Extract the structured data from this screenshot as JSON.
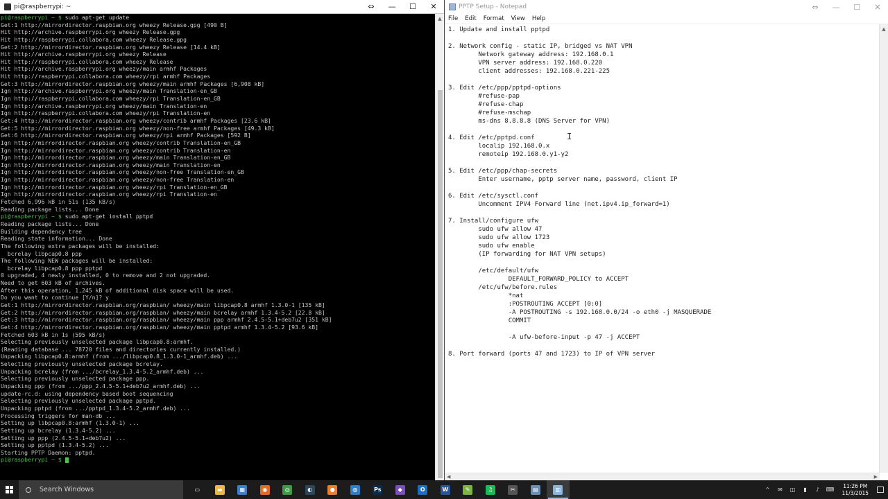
{
  "terminal": {
    "title": "pi@raspberrypi: ~",
    "controls": {
      "resize": "⇔",
      "minimize": "—",
      "maximize": "☐",
      "close": "✕"
    },
    "lines": [
      {
        "prompt": "pi@raspberrypi ~ $ ",
        "text": "sudo apt-get update"
      },
      {
        "text": "Get:1 http://mirrordirector.raspbian.org wheezy Release.gpg [490 B]"
      },
      {
        "text": "Hit http://archive.raspberrypi.org wheezy Release.gpg"
      },
      {
        "text": "Hit http://raspberrypi.collabora.com wheezy Release.gpg"
      },
      {
        "text": "Get:2 http://mirrordirector.raspbian.org wheezy Release [14.4 kB]"
      },
      {
        "text": "Hit http://archive.raspberrypi.org wheezy Release"
      },
      {
        "text": "Hit http://raspberrypi.collabora.com wheezy Release"
      },
      {
        "text": "Hit http://archive.raspberrypi.org wheezy/main armhf Packages"
      },
      {
        "text": "Hit http://raspberrypi.collabora.com wheezy/rpi armhf Packages"
      },
      {
        "text": "Get:3 http://mirrordirector.raspbian.org wheezy/main armhf Packages [6,908 kB]"
      },
      {
        "text": "Ign http://archive.raspberrypi.org wheezy/main Translation-en_GB"
      },
      {
        "text": "Ign http://raspberrypi.collabora.com wheezy/rpi Translation-en_GB"
      },
      {
        "text": "Ign http://archive.raspberrypi.org wheezy/main Translation-en"
      },
      {
        "text": "Ign http://raspberrypi.collabora.com wheezy/rpi Translation-en"
      },
      {
        "text": "Get:4 http://mirrordirector.raspbian.org wheezy/contrib armhf Packages [23.6 kB]"
      },
      {
        "text": "Get:5 http://mirrordirector.raspbian.org wheezy/non-free armhf Packages [49.3 kB]"
      },
      {
        "text": "Get:6 http://mirrordirector.raspbian.org wheezy/rpi armhf Packages [592 B]"
      },
      {
        "text": "Ign http://mirrordirector.raspbian.org wheezy/contrib Translation-en_GB"
      },
      {
        "text": "Ign http://mirrordirector.raspbian.org wheezy/contrib Translation-en"
      },
      {
        "text": "Ign http://mirrordirector.raspbian.org wheezy/main Translation-en_GB"
      },
      {
        "text": "Ign http://mirrordirector.raspbian.org wheezy/main Translation-en"
      },
      {
        "text": "Ign http://mirrordirector.raspbian.org wheezy/non-free Translation-en_GB"
      },
      {
        "text": "Ign http://mirrordirector.raspbian.org wheezy/non-free Translation-en"
      },
      {
        "text": "Ign http://mirrordirector.raspbian.org wheezy/rpi Translation-en_GB"
      },
      {
        "text": "Ign http://mirrordirector.raspbian.org wheezy/rpi Translation-en"
      },
      {
        "text": "Fetched 6,996 kB in 51s (135 kB/s)"
      },
      {
        "text": "Reading package lists... Done"
      },
      {
        "prompt": "pi@raspberrypi ~ $ ",
        "text": "sudo apt-get install pptpd"
      },
      {
        "text": "Reading package lists... Done"
      },
      {
        "text": "Building dependency tree"
      },
      {
        "text": "Reading state information... Done"
      },
      {
        "text": "The following extra packages will be installed:"
      },
      {
        "text": "  bcrelay libpcap0.8 ppp"
      },
      {
        "text": "The following NEW packages will be installed:"
      },
      {
        "text": "  bcrelay libpcap0.8 ppp pptpd"
      },
      {
        "text": "0 upgraded, 4 newly installed, 0 to remove and 2 not upgraded."
      },
      {
        "text": "Need to get 603 kB of archives."
      },
      {
        "text": "After this operation, 1,245 kB of additional disk space will be used."
      },
      {
        "text": "Do you want to continue [Y/n]? y"
      },
      {
        "text": "Get:1 http://mirrordirector.raspbian.org/raspbian/ wheezy/main libpcap0.8 armhf 1.3.0-1 [135 kB]"
      },
      {
        "text": "Get:2 http://mirrordirector.raspbian.org/raspbian/ wheezy/main bcrelay armhf 1.3.4-5.2 [22.8 kB]"
      },
      {
        "text": "Get:3 http://mirrordirector.raspbian.org/raspbian/ wheezy/main ppp armhf 2.4.5-5.1+deb7u2 [351 kB]"
      },
      {
        "text": "Get:4 http://mirrordirector.raspbian.org/raspbian/ wheezy/main pptpd armhf 1.3.4-5.2 [93.6 kB]"
      },
      {
        "text": "Fetched 603 kB in 1s (595 kB/s)"
      },
      {
        "text": "Selecting previously unselected package libpcap0.8:armhf."
      },
      {
        "text": "(Reading database ... 78720 files and directories currently installed.)"
      },
      {
        "text": "Unpacking libpcap0.8:armhf (from .../libpcap0.8_1.3.0-1_armhf.deb) ..."
      },
      {
        "text": "Selecting previously unselected package bcrelay."
      },
      {
        "text": "Unpacking bcrelay (from .../bcrelay_1.3.4-5.2_armhf.deb) ..."
      },
      {
        "text": "Selecting previously unselected package ppp."
      },
      {
        "text": "Unpacking ppp (from .../ppp_2.4.5-5.1+deb7u2_armhf.deb) ..."
      },
      {
        "text": "update-rc.d: using dependency based boot sequencing"
      },
      {
        "text": "Selecting previously unselected package pptpd."
      },
      {
        "text": "Unpacking pptpd (from .../pptpd_1.3.4-5.2_armhf.deb) ..."
      },
      {
        "text": "Processing triggers for man-db ..."
      },
      {
        "text": "Setting up libpcap0.8:armhf (1.3.0-1) ..."
      },
      {
        "text": "Setting up bcrelay (1.3.4-5.2) ..."
      },
      {
        "text": "Setting up ppp (2.4.5-5.1+deb7u2) ..."
      },
      {
        "text": "Setting up pptpd (1.3.4-5.2) ..."
      },
      {
        "text": "Starting PPTP Daemon: pptpd."
      },
      {
        "prompt": "pi@raspberrypi ~ $ ",
        "text": "",
        "cursor": true
      }
    ]
  },
  "notepad": {
    "title": "PPTP Setup - Notepad",
    "controls": {
      "resize": "⇔",
      "minimize": "—",
      "maximize": "☐",
      "close": "✕"
    },
    "menu": [
      "File",
      "Edit",
      "Format",
      "View",
      "Help"
    ],
    "lines": [
      "1. Update and install pptpd",
      "",
      "2. Network config - static IP, bridged vs NAT VPN",
      "        Network gateway address: 192.168.0.1",
      "        VPN server address: 192.168.0.220",
      "        client addresses: 192.168.0.221-225",
      "",
      "3. Edit /etc/ppp/pptpd-options",
      "        #refuse-pap",
      "        #refuse-chap",
      "        #refuse-mschap",
      "        ms-dns 8.8.8.8 (DNS Server for VPN)",
      "",
      "4. Edit /etc/pptpd.conf",
      "        localip 192.168.0.x",
      "        remoteip 192.168.0.y1-y2",
      "",
      "5. Edit /etc/ppp/chap-secrets",
      "        Enter username, pptp server name, password, client IP",
      "",
      "6. Edit /etc/sysctl.conf",
      "        Uncomment IPV4 Forward line (net.ipv4.ip_forward=1)",
      "",
      "7. Install/configure ufw",
      "        sudo ufw allow 47",
      "        sudo ufw allow 1723",
      "        sudo ufw enable",
      "        (IP forwarding for NAT VPN setups)",
      "",
      "        /etc/default/ufw",
      "                DEFAULT_FORWARD_POLICY to ACCEPT",
      "        /etc/ufw/before.rules",
      "                *nat",
      "                :POSTROUTING ACCEPT [0:0]",
      "                -A POSTROUTING -s 192.168.0.0/24 -o eth0 -j MASQUERADE",
      "                COMMIT",
      "",
      "                -A ufw-before-input -p 47 -j ACCEPT",
      "",
      "8. Port forward (ports 47 and 1723) to IP of VPN server"
    ]
  },
  "taskbar": {
    "search_placeholder": "Search Windows",
    "apps": [
      {
        "name": "task-view-icon",
        "glyph": "▭",
        "color": "#1c1c1c"
      },
      {
        "name": "file-explorer-icon",
        "glyph": "▬",
        "color": "#e8b84a"
      },
      {
        "name": "outlook-calendar-icon",
        "glyph": "▦",
        "color": "#3b7fd1"
      },
      {
        "name": "firefox-icon",
        "glyph": "◉",
        "color": "#e66b1e"
      },
      {
        "name": "chrome-icon",
        "glyph": "◎",
        "color": "#3f9a46"
      },
      {
        "name": "steam-icon",
        "glyph": "◐",
        "color": "#2a475e"
      },
      {
        "name": "origin-icon",
        "glyph": "●",
        "color": "#f07d2e"
      },
      {
        "name": "uplay-icon",
        "glyph": "◍",
        "color": "#2d7ec6"
      },
      {
        "name": "photoshop-icon",
        "glyph": "Ps",
        "color": "#0b2b4a"
      },
      {
        "name": "visual-studio-icon",
        "glyph": "◆",
        "color": "#7b4fb7"
      },
      {
        "name": "outlook-icon",
        "glyph": "O",
        "color": "#1d6dc2"
      },
      {
        "name": "word-icon",
        "glyph": "W",
        "color": "#2a5699"
      },
      {
        "name": "notepad-plus-icon",
        "glyph": "✎",
        "color": "#7cb342"
      },
      {
        "name": "spotify-icon",
        "glyph": "♫",
        "color": "#1db954"
      },
      {
        "name": "app-icon",
        "glyph": "✂",
        "color": "#555555"
      },
      {
        "name": "putty-icon",
        "glyph": "▤",
        "color": "#6b8fb5"
      },
      {
        "name": "notepad-icon",
        "glyph": "▥",
        "color": "#8fb4d9",
        "active": true
      }
    ],
    "tray": [
      "^",
      "✉",
      "◫",
      "▮",
      "♪",
      "⌨"
    ],
    "time": "11:26 PM",
    "date": "11/3/2015"
  }
}
